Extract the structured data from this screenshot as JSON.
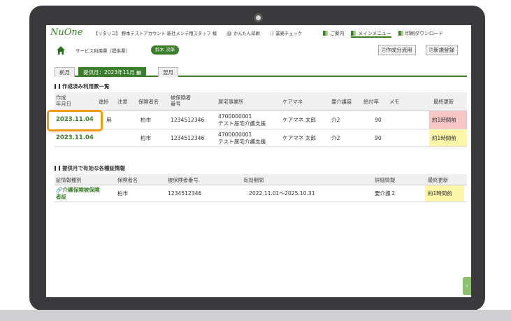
{
  "header": {
    "logo": "NuOne",
    "org": "【リタリコ】 野本テストアカウント 新社メンテ用スタッフ 様",
    "easy_print": "かんたん印刷",
    "biz_check": "業務チェック",
    "nav": [
      "ご案内",
      "メインメニュー",
      "印刷ダウンロード"
    ]
  },
  "toolbar": {
    "breadcrumb": "サービス利用票（提供票）",
    "user": "鈴木 次郎",
    "create_button": "作成分流用",
    "new_button": "新規登録"
  },
  "tabs": {
    "prev": "前月",
    "current": "提供月：2023年11月",
    "next": "翌月"
  },
  "created_section": {
    "title": "作成済み利用票一覧",
    "headers": {
      "created": "作成\n年月日",
      "progress": "進捗",
      "caution": "注意",
      "insurer": "保険者名",
      "insured_no": "被保険者\n番号",
      "office": "居宅事業所",
      "care_manager": "ケアマネ",
      "care_level": "要介護度",
      "benefit_rate": "給付率",
      "memo": "メモ",
      "last_update": "最終更新"
    },
    "rows": [
      {
        "date": "2023.11.04",
        "progress": "用",
        "insurer": "柏市",
        "insured_no": "1234512346",
        "office_code": "4700000001",
        "office_name": "テスト居宅介護支援",
        "care_manager": "ケアマネ 太郎",
        "care_level": "介2",
        "benefit_rate": "90",
        "last_update": "約1時間前"
      },
      {
        "date": "2023.11.04",
        "progress": "",
        "insurer": "柏市",
        "insured_no": "1234512346",
        "office_code": "4700000001",
        "office_name": "テスト居宅介護支援",
        "care_manager": "ケアマネ 太郎",
        "care_level": "介2",
        "benefit_rate": "90",
        "last_update": "約1時間前"
      }
    ]
  },
  "cert_section": {
    "title": "提供月で有効な各種証情報",
    "headers": {
      "type": "証情報種別",
      "insurer": "保険者名",
      "insured_no": "被保険者番号",
      "period": "有効期間",
      "detail": "詳細情報",
      "last_update": "最終更新"
    },
    "rows": [
      {
        "type_line1": "介護保険被保険",
        "type_line2": "者証",
        "insurer": "柏市",
        "insured_no": "1234512346",
        "period": "2022.11.01～2025.10.31",
        "detail": "要介護２",
        "last_update": "約1時間前"
      }
    ]
  },
  "colors": {
    "accent": "#3a7d2a",
    "highlight": "#f19a16",
    "update_red": "#f7c6c6",
    "update_yellow": "#fbf6a8"
  }
}
